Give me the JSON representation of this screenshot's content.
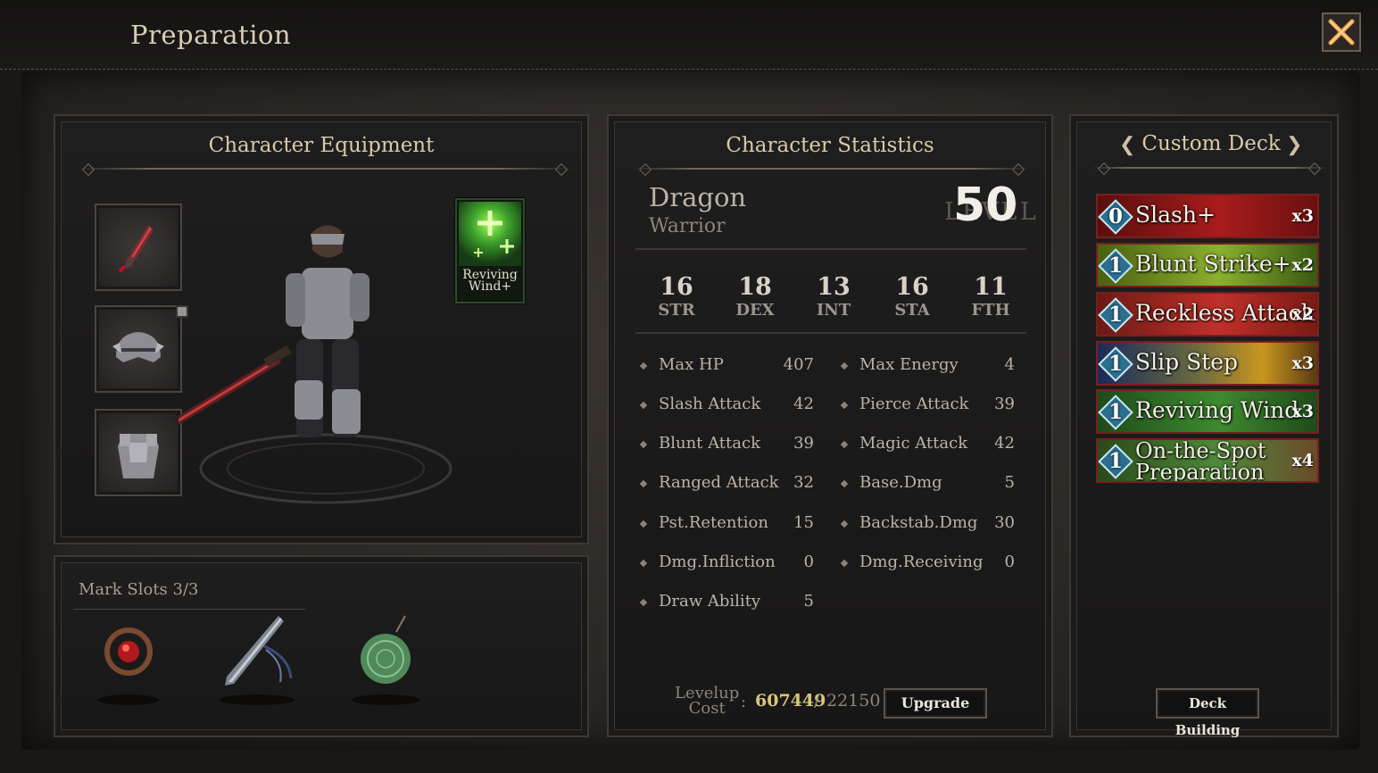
{
  "header": {
    "title": "Preparation"
  },
  "equipment": {
    "title": "Character Equipment",
    "skill_card": {
      "name": "Reviving Wind+"
    }
  },
  "marks": {
    "title": "Mark Slots 3/3"
  },
  "stats": {
    "title": "Character Statistics",
    "name": "Dragon",
    "class": "Warrior",
    "level_label": "LEVEL",
    "level": "50",
    "attributes": [
      {
        "value": "16",
        "label": "STR"
      },
      {
        "value": "18",
        "label": "DEX"
      },
      {
        "value": "13",
        "label": "INT"
      },
      {
        "value": "16",
        "label": "STA"
      },
      {
        "value": "11",
        "label": "FTH"
      }
    ],
    "left": [
      {
        "label": "Max HP",
        "value": "407"
      },
      {
        "label": "Slash Attack",
        "value": "42"
      },
      {
        "label": "Blunt Attack",
        "value": "39"
      },
      {
        "label": "Ranged Attack",
        "value": "32"
      },
      {
        "label": "Pst.Retention",
        "value": "15"
      },
      {
        "label": "Dmg.Infliction",
        "value": "0"
      },
      {
        "label": "Draw Ability",
        "value": "5"
      }
    ],
    "right": [
      {
        "label": "Max Energy",
        "value": "4"
      },
      {
        "label": "Pierce Attack",
        "value": "39"
      },
      {
        "label": "Magic Attack",
        "value": "42"
      },
      {
        "label": "Base.Dmg",
        "value": "5"
      },
      {
        "label": "Backstab.Dmg",
        "value": "30"
      },
      {
        "label": "Dmg.Receiving",
        "value": "0"
      }
    ],
    "levelup": {
      "label_line1": "Levelup",
      "label_line2": "Cost",
      "colon": ":",
      "current": "607449",
      "separator": "/",
      "required": "22150"
    },
    "upgrade_label": "Upgrade"
  },
  "deck": {
    "title": "Custom Deck",
    "prev": "❮",
    "next": "❯",
    "cards": [
      {
        "cost": "0",
        "name": "Slash+",
        "count": "x3",
        "color": "#a81c1c"
      },
      {
        "cost": "1",
        "name": "Blunt Strike+",
        "count": "x2",
        "color": "#6f9a1e"
      },
      {
        "cost": "1",
        "name": "Reckless Attack",
        "count": "x2",
        "color": "#b22a22"
      },
      {
        "cost": "1",
        "name": "Slip Step",
        "count": "x3",
        "color": "#b88a1f"
      },
      {
        "cost": "1",
        "name": "Reviving Wind",
        "count": "x3",
        "color": "#2f7a2a"
      },
      {
        "cost": "1",
        "name": "On-the-Spot Preparation",
        "count": "x4",
        "color": "#3f7a2c"
      }
    ],
    "build_label": "Deck Building"
  }
}
